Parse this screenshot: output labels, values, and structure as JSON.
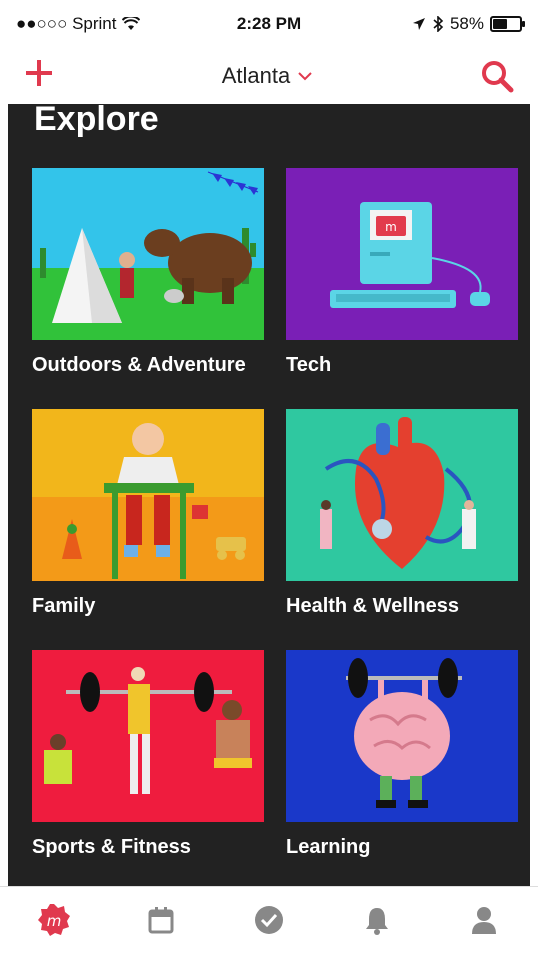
{
  "status_bar": {
    "carrier": "●●○○○ Sprint",
    "time": "2:28 PM",
    "battery": "58%",
    "battery_level": 0.58
  },
  "nav": {
    "city": "Atlanta"
  },
  "explore": {
    "title": "Explore",
    "categories": [
      {
        "label": "Outdoors & Adventure"
      },
      {
        "label": "Tech"
      },
      {
        "label": "Family"
      },
      {
        "label": "Health & Wellness"
      },
      {
        "label": "Sports & Fitness"
      },
      {
        "label": "Learning"
      }
    ]
  },
  "colors": {
    "accent": "#e0394e",
    "content_bg": "#222222"
  },
  "tabs": [
    {
      "icon": "meetup-logo-icon"
    },
    {
      "icon": "calendar-icon"
    },
    {
      "icon": "check-circle-icon"
    },
    {
      "icon": "bell-icon"
    },
    {
      "icon": "profile-icon"
    }
  ]
}
